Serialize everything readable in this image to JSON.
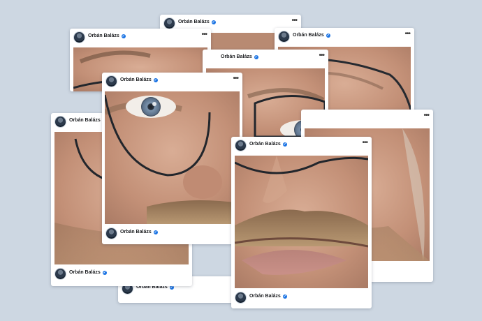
{
  "post": {
    "author": "Orbán Balázs",
    "verified_badge": "✓",
    "more_menu": "•••"
  },
  "colors": {
    "background": "#cdd7e2",
    "card": "#ffffff",
    "verified_blue": "#1b74e4",
    "skin": "#c99a80",
    "iris": "#6f8aa6"
  },
  "icons": [
    "avatar",
    "verified-badge-icon",
    "more-options-icon"
  ]
}
